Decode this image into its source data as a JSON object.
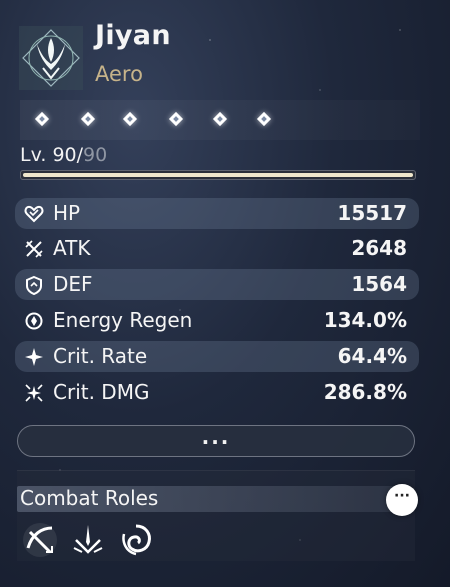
{
  "character": {
    "name": "Jiyan",
    "element": "Aero",
    "emblem_icon": "aero-emblem-icon"
  },
  "sequence": {
    "count": 6,
    "unlocked": 6
  },
  "level": {
    "prefix": "Lv. ",
    "current": "90",
    "separator": "/",
    "max": "90",
    "progress": 1.0
  },
  "stats": [
    {
      "icon": "hp-heart-icon",
      "label": "HP",
      "value": "15517"
    },
    {
      "icon": "atk-swords-icon",
      "label": "ATK",
      "value": "2648"
    },
    {
      "icon": "def-shield-icon",
      "label": "DEF",
      "value": "1564"
    },
    {
      "icon": "energy-regen-icon",
      "label": "Energy Regen",
      "value": "134.0%"
    },
    {
      "icon": "crit-rate-icon",
      "label": "Crit. Rate",
      "value": "64.4%"
    },
    {
      "icon": "crit-dmg-icon",
      "label": "Crit. DMG",
      "value": "286.8%"
    }
  ],
  "more_button": {
    "label": "···"
  },
  "combat_roles": {
    "title": "Combat Roles",
    "info_label": "···",
    "roles": [
      {
        "icon": "heavy-slash-role-icon"
      },
      {
        "icon": "sword-burst-role-icon"
      },
      {
        "icon": "aero-swirl-role-icon"
      }
    ]
  },
  "colors": {
    "element_text": "#c6b38a",
    "level_fill": "#efe7cc",
    "max_level_text": "#8f96a3"
  }
}
